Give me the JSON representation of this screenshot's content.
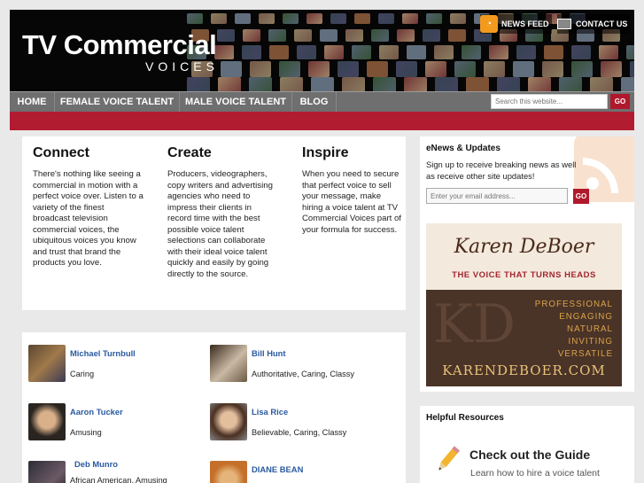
{
  "header": {
    "logo_line1": "TV Commercial",
    "logo_line2": "VOICES",
    "news_feed": "NEWS FEED",
    "contact_us": "CONTACT US"
  },
  "nav": {
    "items": [
      "HOME",
      "FEMALE VOICE TALENT",
      "MALE VOICE TALENT",
      "BLOG"
    ],
    "search_placeholder": "Search this website...",
    "search_go": "GO"
  },
  "intro": {
    "columns": [
      {
        "title": "Connect",
        "text": "There's nothing like seeing a commercial in motion with a perfect voice over. Listen to a variety of the finest broadcast television commercial voices, the ubiquitous voices you know and trust that brand the products you love."
      },
      {
        "title": "Create",
        "text": "Producers, videographers, copy writers and advertising agencies who need to impress their clients in record time with the best possible voice talent selections can collaborate with their ideal voice talent quickly and easily by going directly to the source."
      },
      {
        "title": "Inspire",
        "text": "When you need to secure that perfect voice to sell your message, make hiring a voice talent at TV Commercial Voices part of your formula for success."
      }
    ]
  },
  "people": [
    {
      "name": "Michael Turnbull",
      "tags": "Caring"
    },
    {
      "name": "Bill Hunt",
      "tags": "Authoritative, Caring, Classy"
    },
    {
      "name": "Aaron Tucker",
      "tags": "Amusing"
    },
    {
      "name": "Lisa Rice",
      "tags": "Believable, Caring, Classy"
    },
    {
      "name": "Deb Munro",
      "tags": "African American, Amusing"
    },
    {
      "name": "DIANE BEAN",
      "tags": ""
    }
  ],
  "sidebar": {
    "enews_title": "eNews & Updates",
    "enews_text": "Sign up to receive breaking news as well as receive other site updates!",
    "email_placeholder": "Enter your email address...",
    "email_go": "GO",
    "ad": {
      "name": "Karen DeBoer",
      "tagline": "THE VOICE THAT TURNS HEADS",
      "monogram": "KD",
      "words": [
        "PROFESSIONAL",
        "ENGAGING",
        "NATURAL",
        "INVITING",
        "VERSATILE"
      ],
      "url": "KARENDEBOER.COM"
    },
    "helpful_title": "Helpful Resources",
    "guide_title": "Check out the Guide",
    "guide_sub": "Learn how to hire a voice talent"
  },
  "colors": {
    "accent_red": "#b21c30",
    "link_blue": "#2a5aa0",
    "nav_gray": "#6f6f6f",
    "rss_orange": "#f39a1e"
  }
}
